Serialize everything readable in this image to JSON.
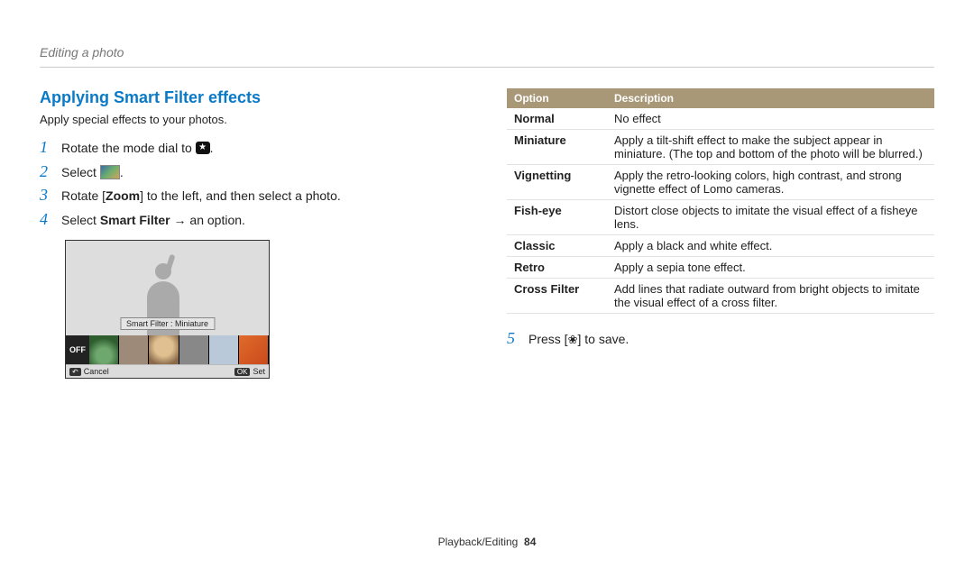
{
  "breadcrumb": "Editing a photo",
  "title": "Applying Smart Filter effects",
  "intro": "Apply special effects to your photos.",
  "steps": {
    "s1_a": "Rotate the mode dial to ",
    "s1_b": ".",
    "s2_a": "Select ",
    "s2_b": ".",
    "s3_a": "Rotate [",
    "s3_bold": "Zoom",
    "s3_b": "] to the left, and then select a photo.",
    "s4_a": "Select ",
    "s4_bold": "Smart Filter",
    "s4_b": " → an option.",
    "s5_a": "Press [",
    "s5_b": "] to save."
  },
  "mode_icon": "★",
  "macro_icon": "❀",
  "preview": {
    "label": "Smart Filter : Miniature",
    "off": "OFF",
    "cancel_key": "↶",
    "cancel": "Cancel",
    "set_key": "OK",
    "set": "Set"
  },
  "table": {
    "h1": "Option",
    "h2": "Description",
    "rows": [
      {
        "opt": "Normal",
        "desc": "No effect"
      },
      {
        "opt": "Miniature",
        "desc": "Apply a tilt-shift effect to make the subject appear in miniature. (The top and bottom of the photo will be blurred.)"
      },
      {
        "opt": "Vignetting",
        "desc": "Apply the retro-looking colors, high contrast, and strong vignette effect of Lomo cameras."
      },
      {
        "opt": "Fish-eye",
        "desc": "Distort close objects to imitate the visual effect of a fisheye lens."
      },
      {
        "opt": "Classic",
        "desc": "Apply a black and white effect."
      },
      {
        "opt": "Retro",
        "desc": "Apply a sepia tone effect."
      },
      {
        "opt": "Cross Filter",
        "desc": "Add lines that radiate outward from bright objects to imitate the visual effect of a cross filter."
      }
    ]
  },
  "footer": {
    "section": "Playback/Editing",
    "page": "84"
  }
}
